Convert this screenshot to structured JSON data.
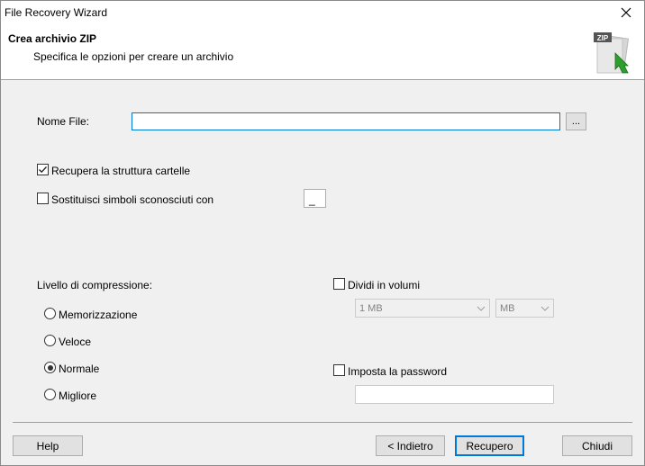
{
  "window": {
    "title": "File Recovery Wizard",
    "close_icon": "close-icon"
  },
  "header": {
    "title": "Crea archivio ZIP",
    "subtitle": "Specifica le opzioni per creare un archivio",
    "zip_label": "ZIP",
    "accent_color": "#2e9e2e"
  },
  "form": {
    "file_name_label": "Nome File:",
    "file_name_value": "",
    "browse_label": "...",
    "recover_structure_label": "Recupera la struttura cartelle",
    "recover_structure_checked": true,
    "replace_symbols_label": "Sostituisci simboli sconosciuti con",
    "replace_symbols_checked": false,
    "replace_symbol_value": "_"
  },
  "compression": {
    "label": "Livello di compressione:",
    "options": [
      {
        "label": "Memorizzazione",
        "selected": false
      },
      {
        "label": "Veloce",
        "selected": false
      },
      {
        "label": "Normale",
        "selected": true
      },
      {
        "label": "Migliore",
        "selected": false
      }
    ]
  },
  "volumes": {
    "label": "Dividi in volumi",
    "checked": false,
    "size_value": "1 MB",
    "unit_value": "MB"
  },
  "password": {
    "label": "Imposta la password",
    "checked": false,
    "value": ""
  },
  "buttons": {
    "help": "Help",
    "back": "< Indietro",
    "recover": "Recupero",
    "close": "Chiudi"
  }
}
